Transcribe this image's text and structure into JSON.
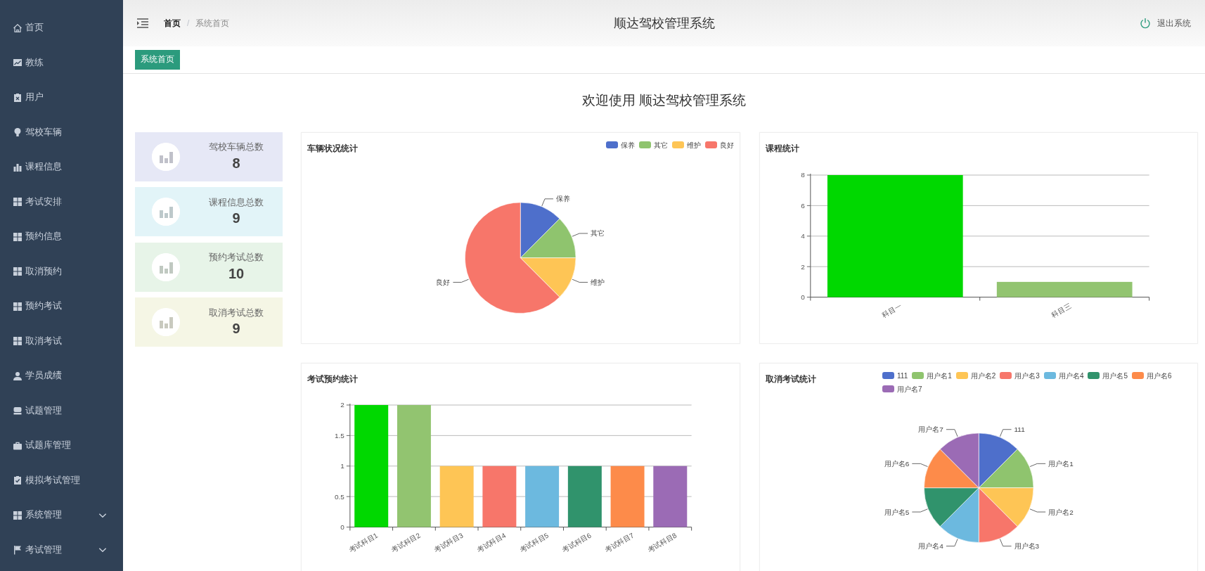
{
  "sidebar": {
    "items": [
      {
        "label": "首页",
        "expandable": false
      },
      {
        "label": "教练",
        "expandable": false
      },
      {
        "label": "用户",
        "expandable": false
      },
      {
        "label": "驾校车辆",
        "expandable": false
      },
      {
        "label": "课程信息",
        "expandable": false
      },
      {
        "label": "考试安排",
        "expandable": false
      },
      {
        "label": "预约信息",
        "expandable": false
      },
      {
        "label": "取消预约",
        "expandable": false
      },
      {
        "label": "预约考试",
        "expandable": false
      },
      {
        "label": "取消考试",
        "expandable": false
      },
      {
        "label": "学员成绩",
        "expandable": false
      },
      {
        "label": "试题管理",
        "expandable": false
      },
      {
        "label": "试题库管理",
        "expandable": false
      },
      {
        "label": "模拟考试管理",
        "expandable": false
      },
      {
        "label": "系统管理",
        "expandable": true
      },
      {
        "label": "考试管理",
        "expandable": true
      }
    ]
  },
  "header": {
    "breadcrumb": [
      {
        "label": "首页",
        "current": false
      },
      {
        "label": "系统首页",
        "current": true
      }
    ],
    "breadcrumb_separator": "/",
    "title": "顺达驾校管理系统",
    "logout": "退出系统"
  },
  "tags": [
    {
      "label": "系统首页",
      "selected": true
    }
  ],
  "welcome": "欢迎使用 顺达驾校管理系统",
  "stats": [
    {
      "label": "驾校车辆总数",
      "value": "8",
      "color": "#e6e8f6"
    },
    {
      "label": "课程信息总数",
      "value": "9",
      "color": "#e2f4f8"
    },
    {
      "label": "预约考试总数",
      "value": "10",
      "color": "#e7f4e8"
    },
    {
      "label": "取消考试总数",
      "value": "9",
      "color": "#f5f6e5"
    }
  ],
  "charts": [
    {
      "title": "车辆状况统计",
      "show_legend": true,
      "chart_data": {
        "type": "pie",
        "categories": [
          "保养",
          "其它",
          "维护",
          "良好"
        ],
        "values": [
          12.5,
          12.5,
          12.5,
          62.5
        ],
        "colors": [
          "#4e6fcb",
          "#8fc46e",
          "#fec555",
          "#f7766a"
        ]
      }
    },
    {
      "title": "课程统计",
      "show_legend": false,
      "chart_data": {
        "type": "bar",
        "categories": [
          "科目一",
          "科目三"
        ],
        "series": [
          {
            "values": [
              8,
              1
            ],
            "colors": [
              "#00d800",
              "#92c470"
            ]
          }
        ],
        "yticks": [
          0,
          2,
          4,
          6,
          8
        ],
        "ylim": [
          0,
          8
        ],
        "grid": true
      }
    },
    {
      "title": "考试预约统计",
      "show_legend": false,
      "chart_data": {
        "type": "bar",
        "categories": [
          "考试科目1",
          "考试科目2",
          "考试科目3",
          "考试科目4",
          "考试科目5",
          "考试科目6",
          "考试科目7",
          "考试科目8"
        ],
        "series": [
          {
            "values": [
              2,
              2,
              1,
              1,
              1,
              1,
              1,
              1
            ],
            "colors": [
              "#00d800",
              "#92c470",
              "#fec555",
              "#f7766a",
              "#6cb9df",
              "#30936c",
              "#fd8b4a",
              "#9b6bb5"
            ]
          }
        ],
        "yticks": [
          0,
          0.5,
          1,
          1.5,
          2
        ],
        "ylim": [
          0,
          2
        ],
        "grid": true
      }
    },
    {
      "title": "取消考试统计",
      "show_legend": true,
      "chart_data": {
        "type": "pie",
        "categories": [
          "111",
          "用户名1",
          "用户名2",
          "用户名3",
          "用户名4",
          "用户名5",
          "用户名6",
          "用户名7"
        ],
        "values": [
          12.5,
          12.5,
          12.5,
          12.5,
          12.5,
          12.5,
          12.5,
          12.5
        ],
        "colors": [
          "#4e6fcb",
          "#8fc46e",
          "#fec555",
          "#f7766a",
          "#6cb9df",
          "#30936c",
          "#fd8b4a",
          "#9b6bb5"
        ]
      }
    }
  ]
}
